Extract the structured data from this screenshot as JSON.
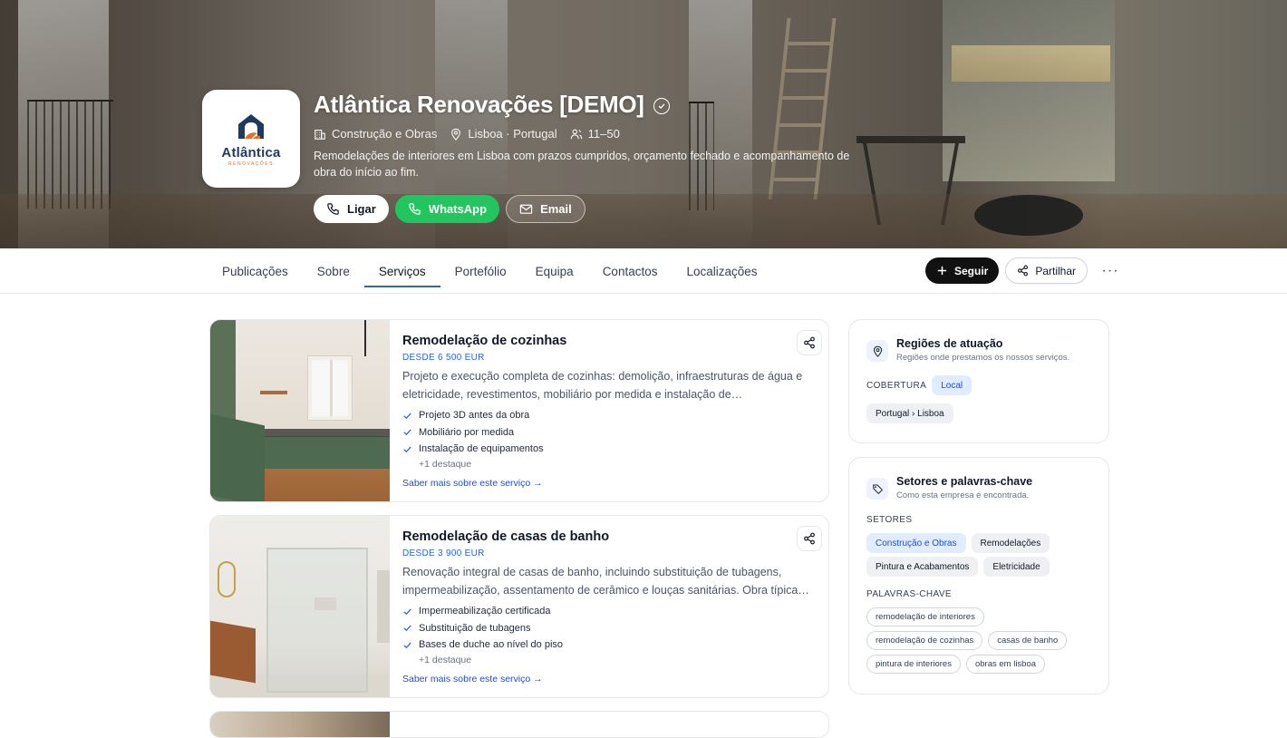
{
  "company": {
    "name": "Atlântica Renovações [DEMO]",
    "logo_word": "Atlântica",
    "logo_sub": "RENOVAÇÕES",
    "sector": "Construção e Obras",
    "location": "Lisboa · Portugal",
    "size": "11–50",
    "tagline": "Remodelações de interiores em Lisboa com prazos cumpridos, orçamento fechado e acompanhamento de obra do início ao fim."
  },
  "hero_actions": {
    "call": "Ligar",
    "whatsapp": "WhatsApp",
    "email": "Email"
  },
  "tabs": [
    "Publicações",
    "Sobre",
    "Serviços",
    "Portefólio",
    "Equipa",
    "Contactos",
    "Localizações"
  ],
  "active_tab": "Serviços",
  "nav_actions": {
    "follow": "Seguir",
    "share": "Partilhar",
    "more": "···"
  },
  "services": [
    {
      "title": "Remodelação de cozinhas",
      "price": "DESDE 6 500 EUR",
      "description": "Projeto e execução completa de cozinhas: demolição, infraestruturas de água e eletricidade, revestimentos, mobiliário por medida e instalação de…",
      "highlights": [
        "Projeto 3D antes da obra",
        "Mobiliário por medida",
        "Instalação de equipamentos"
      ],
      "more_highlights": "+1 destaque",
      "link": "Saber mais sobre este serviço →"
    },
    {
      "title": "Remodelação de casas de banho",
      "price": "DESDE 3 900 EUR",
      "description": "Renovação integral de casas de banho, incluindo substituição de tubagens, impermeabilização, assentamento de cerâmico e louças sanitárias. Obra típica…",
      "highlights": [
        "Impermeabilização certificada",
        "Substituição de tubagens",
        "Bases de duche ao nível do piso"
      ],
      "more_highlights": "+1 destaque",
      "link": "Saber mais sobre este serviço →"
    }
  ],
  "regions": {
    "title": "Regiões de atuação",
    "subtitle": "Regiões onde prestamos os nossos serviços.",
    "coverage_label": "COBERTURA",
    "coverage_value": "Local",
    "region": "Portugal › Lisboa"
  },
  "sectors": {
    "title": "Setores e palavras-chave",
    "subtitle": "Como esta empresa é encontrada.",
    "sectors_label": "SETORES",
    "sectors": [
      "Construção e Obras",
      "Remodelações",
      "Pintura e Acabamentos",
      "Eletricidade"
    ],
    "keywords_label": "PALAVRAS-CHAVE",
    "keywords": [
      "remodelação de interiores",
      "remodelação de cozinhas",
      "casas de banho",
      "pintura de interiores",
      "obras em lisboa"
    ]
  },
  "colors": {
    "accent_blue": "#1d4ed8",
    "whatsapp_green": "#22c55e",
    "tab_underline": "#2b6f8f",
    "logo_navy": "#1f3a5f",
    "logo_orange": "#e0712c"
  }
}
